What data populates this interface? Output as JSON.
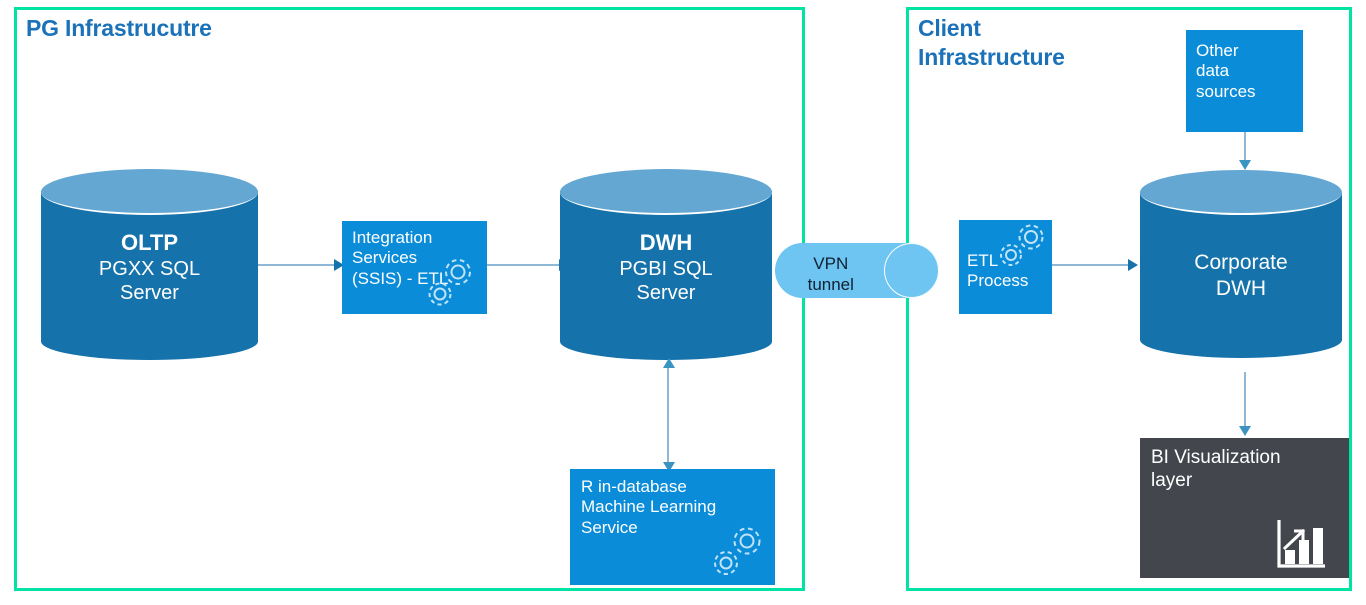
{
  "colors": {
    "frame_border": "#00e3a4",
    "zone_title": "#1b72b8",
    "cylinder_body": "#1572aa",
    "cylinder_top": "#63a7d2",
    "box_blue": "#0b8cd9",
    "box_dark": "#43474d",
    "vpn_fill": "#6ec5f2",
    "connector": "#8fb8d6",
    "page_background": "#ffffff"
  },
  "zones": {
    "pg": {
      "title": "PG Infrastrucutre"
    },
    "client": {
      "title": "Client\nInfrastructure"
    }
  },
  "nodes": {
    "oltp": {
      "title": "OLTP",
      "subtitle": "PGXX SQL\nServer",
      "shape": "cylinder"
    },
    "ssis": {
      "label": "Integration\nServices\n(SSIS) - ETL",
      "shape": "box",
      "icon": "gears-icon"
    },
    "dwh": {
      "title": "DWH",
      "subtitle": "PGBI SQL\nServer",
      "shape": "cylinder"
    },
    "r_ml": {
      "label": "R in-database\nMachine Learning\nService",
      "shape": "box",
      "icon": "gears-icon"
    },
    "vpn": {
      "label": "VPN\ntunnel",
      "shape": "tunnel"
    },
    "etl_process": {
      "label": "ETL\nProcess",
      "shape": "box",
      "icon": "gears-icon"
    },
    "other_sources": {
      "label": "Other\ndata\nsources",
      "shape": "box"
    },
    "corporate_dwh": {
      "title": "",
      "subtitle": "Corporate\nDWH",
      "shape": "cylinder"
    },
    "bi_layer": {
      "label": "BI Visualization\nlayer",
      "shape": "box",
      "icon": "bar-chart-trend-icon"
    }
  },
  "connections": [
    {
      "from": "oltp",
      "to": "ssis",
      "direction": "right"
    },
    {
      "from": "ssis",
      "to": "dwh",
      "direction": "right"
    },
    {
      "from": "dwh",
      "to": "r_ml",
      "direction": "bidirectional-vertical"
    },
    {
      "from": "etl_process",
      "to": "corporate_dwh",
      "direction": "right"
    },
    {
      "from": "other_sources",
      "to": "corporate_dwh",
      "direction": "down"
    },
    {
      "from": "corporate_dwh",
      "to": "bi_layer",
      "direction": "down"
    }
  ]
}
